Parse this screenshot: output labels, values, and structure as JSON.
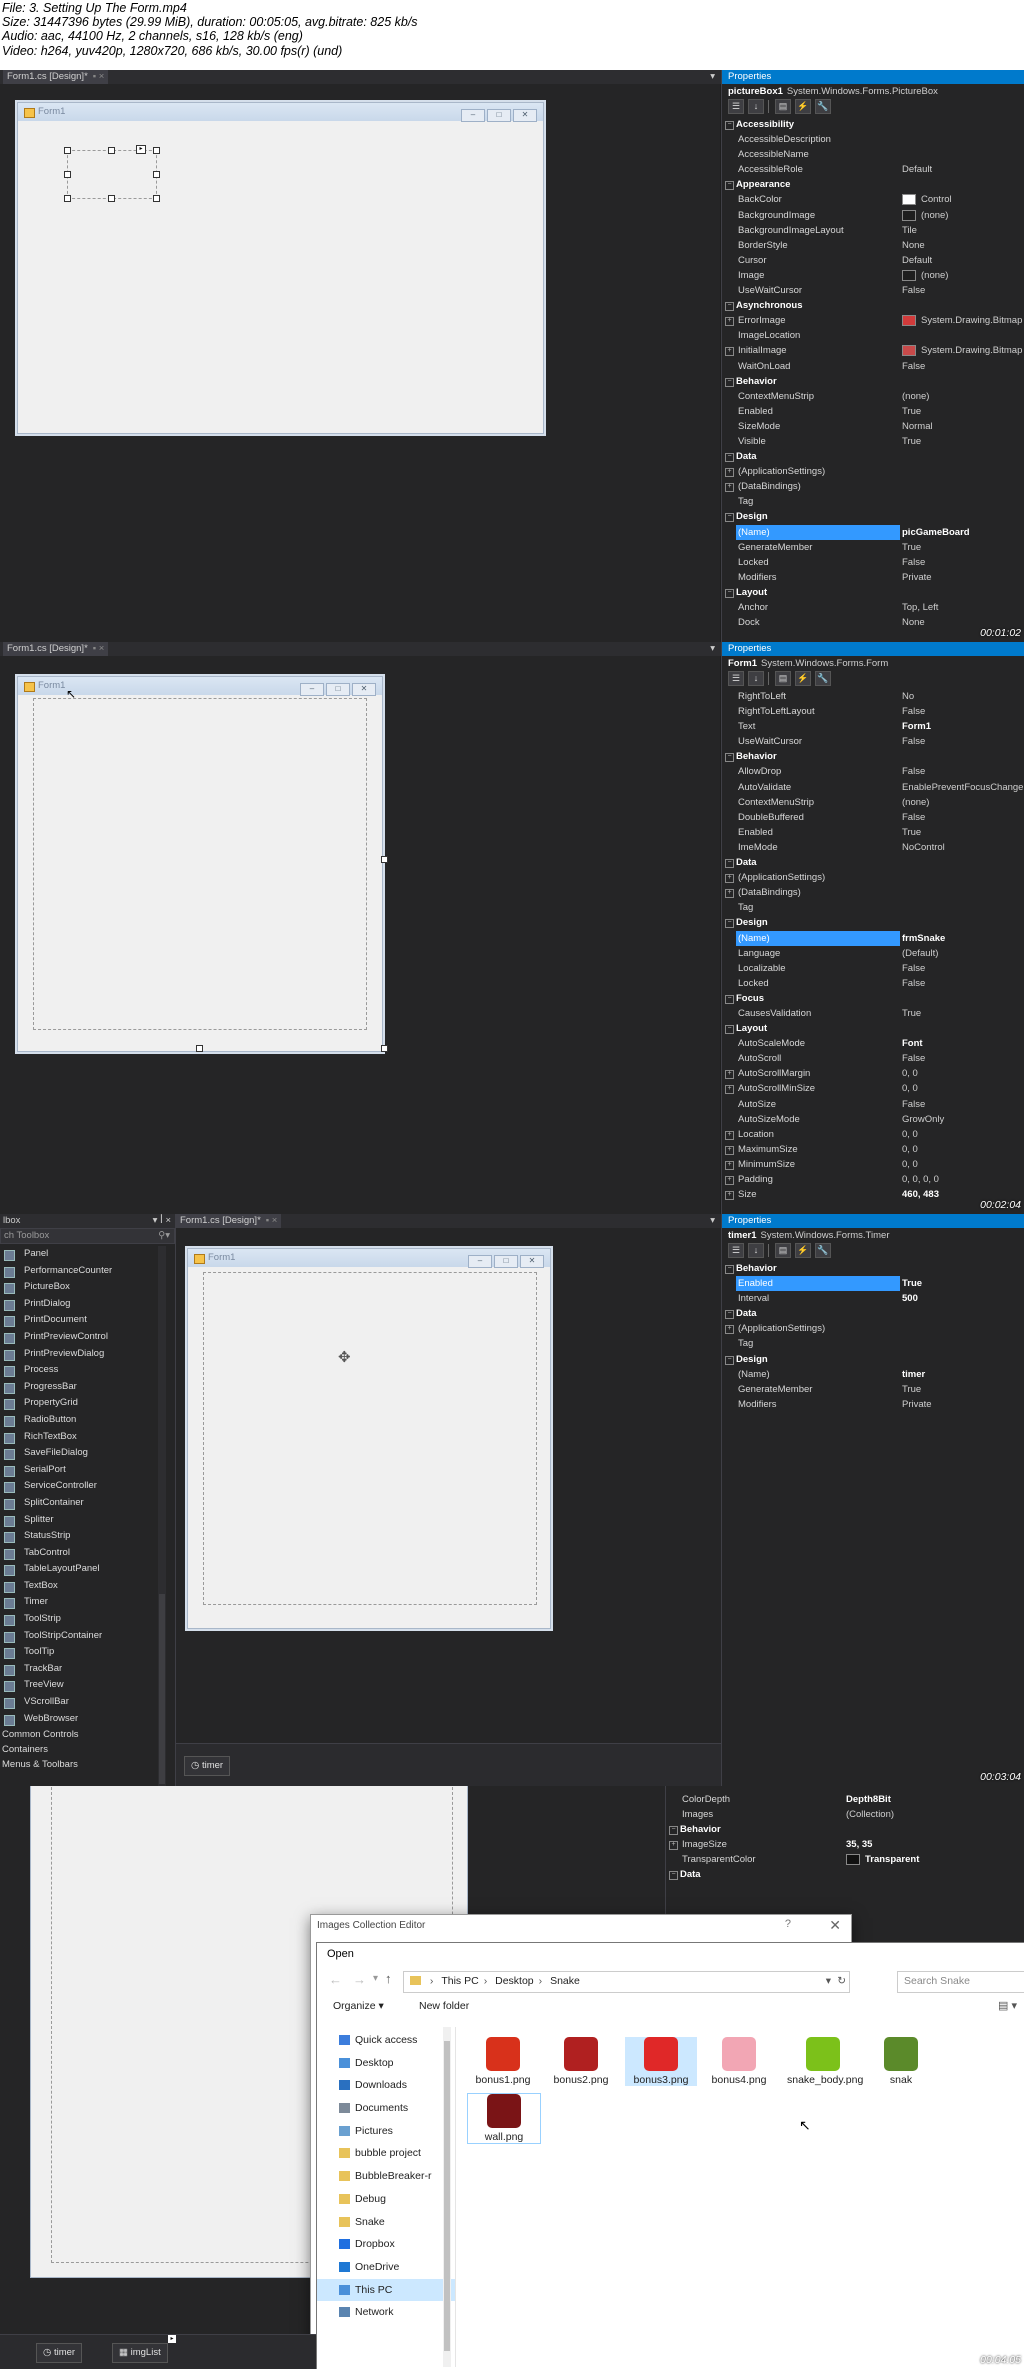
{
  "info": {
    "line1": "File: 3. Setting Up The Form.mp4",
    "line2": "Size: 31447396 bytes (29.99 MiB), duration: 00:05:05, avg.bitrate: 825 kb/s",
    "line3": "Audio: aac, 44100 Hz, 2 channels, s16, 128 kb/s (eng)",
    "line4": "Video: h264, yuv420p, 1280x720, 686 kb/s, 30.00 fps(r) (und)"
  },
  "frame1": {
    "tab": "Form1.cs [Design]*",
    "form_title": "Form1",
    "props_header": "Properties",
    "object": "pictureBox1",
    "object_type": "System.Windows.Forms.PictureBox",
    "timestamp": "00:01:02",
    "rows": [
      {
        "cat": "Accessibility"
      },
      {
        "n": "AccessibleDescription",
        "v": ""
      },
      {
        "n": "AccessibleName",
        "v": ""
      },
      {
        "n": "AccessibleRole",
        "v": "Default"
      },
      {
        "cat": "Appearance"
      },
      {
        "n": "BackColor",
        "v": "Control",
        "sw": "#ffffff"
      },
      {
        "n": "BackgroundImage",
        "v": "(none)",
        "sw": "#1e1e1e"
      },
      {
        "n": "BackgroundImageLayout",
        "v": "Tile"
      },
      {
        "n": "BorderStyle",
        "v": "None"
      },
      {
        "n": "Cursor",
        "v": "Default"
      },
      {
        "n": "Image",
        "v": "(none)",
        "sw": "#1e1e1e"
      },
      {
        "n": "UseWaitCursor",
        "v": "False"
      },
      {
        "cat": "Asynchronous"
      },
      {
        "n": "ErrorImage",
        "v": "System.Drawing.Bitmap",
        "sw": "#d23b3b",
        "exp": true
      },
      {
        "n": "ImageLocation",
        "v": ""
      },
      {
        "n": "InitialImage",
        "v": "System.Drawing.Bitmap",
        "sw": "#c84a4a",
        "exp": true
      },
      {
        "n": "WaitOnLoad",
        "v": "False"
      },
      {
        "cat": "Behavior"
      },
      {
        "n": "ContextMenuStrip",
        "v": "(none)"
      },
      {
        "n": "Enabled",
        "v": "True"
      },
      {
        "n": "SizeMode",
        "v": "Normal"
      },
      {
        "n": "Visible",
        "v": "True"
      },
      {
        "cat": "Data"
      },
      {
        "n": "(ApplicationSettings)",
        "v": "",
        "exp": true
      },
      {
        "n": "(DataBindings)",
        "v": "",
        "exp": true
      },
      {
        "n": "Tag",
        "v": ""
      },
      {
        "cat": "Design"
      },
      {
        "n": "(Name)",
        "v": "picGameBoard",
        "sel": true,
        "bold": true
      },
      {
        "n": "GenerateMember",
        "v": "True"
      },
      {
        "n": "Locked",
        "v": "False"
      },
      {
        "n": "Modifiers",
        "v": "Private"
      },
      {
        "cat": "Layout"
      },
      {
        "n": "Anchor",
        "v": "Top, Left"
      },
      {
        "n": "Dock",
        "v": "None"
      }
    ]
  },
  "frame2": {
    "tab": "Form1.cs [Design]*",
    "form_title": "Form1",
    "props_header": "Properties",
    "object": "Form1",
    "object_type": "System.Windows.Forms.Form",
    "timestamp": "00:02:04",
    "rows": [
      {
        "n": "RightToLeft",
        "v": "No"
      },
      {
        "n": "RightToLeftLayout",
        "v": "False"
      },
      {
        "n": "Text",
        "v": "Form1",
        "bold": true
      },
      {
        "n": "UseWaitCursor",
        "v": "False"
      },
      {
        "cat": "Behavior"
      },
      {
        "n": "AllowDrop",
        "v": "False"
      },
      {
        "n": "AutoValidate",
        "v": "EnablePreventFocusChange"
      },
      {
        "n": "ContextMenuStrip",
        "v": "(none)"
      },
      {
        "n": "DoubleBuffered",
        "v": "False"
      },
      {
        "n": "Enabled",
        "v": "True"
      },
      {
        "n": "ImeMode",
        "v": "NoControl"
      },
      {
        "cat": "Data"
      },
      {
        "n": "(ApplicationSettings)",
        "v": "",
        "exp": true
      },
      {
        "n": "(DataBindings)",
        "v": "",
        "exp": true
      },
      {
        "n": "Tag",
        "v": ""
      },
      {
        "cat": "Design"
      },
      {
        "n": "(Name)",
        "v": "frmSnake",
        "sel": true,
        "bold": true
      },
      {
        "n": "Language",
        "v": "(Default)"
      },
      {
        "n": "Localizable",
        "v": "False"
      },
      {
        "n": "Locked",
        "v": "False"
      },
      {
        "cat": "Focus"
      },
      {
        "n": "CausesValidation",
        "v": "True"
      },
      {
        "cat": "Layout"
      },
      {
        "n": "AutoScaleMode",
        "v": "Font",
        "bold": true
      },
      {
        "n": "AutoScroll",
        "v": "False"
      },
      {
        "n": "AutoScrollMargin",
        "v": "0, 0",
        "exp": true
      },
      {
        "n": "AutoScrollMinSize",
        "v": "0, 0",
        "exp": true
      },
      {
        "n": "AutoSize",
        "v": "False"
      },
      {
        "n": "AutoSizeMode",
        "v": "GrowOnly"
      },
      {
        "n": "Location",
        "v": "0, 0",
        "exp": true
      },
      {
        "n": "MaximumSize",
        "v": "0, 0",
        "exp": true
      },
      {
        "n": "MinimumSize",
        "v": "0, 0",
        "exp": true
      },
      {
        "n": "Padding",
        "v": "0, 0, 0, 0",
        "exp": true
      },
      {
        "n": "Size",
        "v": "460, 483",
        "bold": true,
        "exp": true
      }
    ]
  },
  "frame3": {
    "toolbox_title": "lbox",
    "toolbox_search": "ch Toolbox",
    "toolbox_items": [
      "Panel",
      "PerformanceCounter",
      "PictureBox",
      "PrintDialog",
      "PrintDocument",
      "PrintPreviewControl",
      "PrintPreviewDialog",
      "Process",
      "ProgressBar",
      "PropertyGrid",
      "RadioButton",
      "RichTextBox",
      "SaveFileDialog",
      "SerialPort",
      "ServiceController",
      "SplitContainer",
      "Splitter",
      "StatusStrip",
      "TabControl",
      "TableLayoutPanel",
      "TextBox",
      "Timer",
      "ToolStrip",
      "ToolStripContainer",
      "ToolTip",
      "TrackBar",
      "TreeView",
      "VScrollBar",
      "WebBrowser"
    ],
    "toolbox_groups": [
      "Common Controls",
      "Containers",
      "Menus & Toolbars"
    ],
    "tab": "Form1.cs [Design]*",
    "form_title": "Form1",
    "tray_item": "timer",
    "props_header": "Properties",
    "object": "timer1",
    "object_type": "System.Windows.Forms.Timer",
    "timestamp": "00:03:04",
    "rows": [
      {
        "cat": "Behavior"
      },
      {
        "n": "Enabled",
        "v": "True",
        "sel": true,
        "bold": true
      },
      {
        "n": "Interval",
        "v": "500",
        "bold": true
      },
      {
        "cat": "Data"
      },
      {
        "n": "(ApplicationSettings)",
        "v": "",
        "exp": true
      },
      {
        "n": "Tag",
        "v": ""
      },
      {
        "cat": "Design"
      },
      {
        "n": "(Name)",
        "v": "timer",
        "bold": true
      },
      {
        "n": "GenerateMember",
        "v": "True"
      },
      {
        "n": "Modifiers",
        "v": "Private"
      }
    ]
  },
  "frame4": {
    "timestamp": "00:04:05",
    "props_rows": [
      {
        "n": "ColorDepth",
        "v": "Depth8Bit",
        "bold": true
      },
      {
        "n": "Images",
        "v": "(Collection)"
      },
      {
        "cat": "Behavior"
      },
      {
        "n": "ImageSize",
        "v": "35, 35",
        "bold": true,
        "exp": true
      },
      {
        "n": "TransparentColor",
        "v": "Transparent",
        "bold": true,
        "sw": "#111111"
      },
      {
        "cat": "Data"
      }
    ],
    "collection_editor_title": "Images Collection Editor",
    "collection_help": "?",
    "open_title": "Open",
    "breadcrumb": [
      "This PC",
      "Desktop",
      "Snake"
    ],
    "search_placeholder": "Search Snake",
    "organize": "Organize ▾",
    "new_folder": "New folder",
    "nav": [
      {
        "label": "Quick access",
        "icon": "#3c7ddc"
      },
      {
        "label": "Desktop",
        "icon": "#4a90d9"
      },
      {
        "label": "Downloads",
        "icon": "#2a70c0"
      },
      {
        "label": "Documents",
        "icon": "#7d8a99"
      },
      {
        "label": "Pictures",
        "icon": "#6aa0d0"
      },
      {
        "label": "bubble project",
        "icon": "#e8c35a"
      },
      {
        "label": "BubbleBreaker-r",
        "icon": "#e8c35a"
      },
      {
        "label": "Debug",
        "icon": "#e8c35a"
      },
      {
        "label": "Snake",
        "icon": "#e8c35a"
      },
      {
        "label": "Dropbox",
        "icon": "#1f6fe0"
      },
      {
        "label": "OneDrive",
        "icon": "#1e78d4"
      },
      {
        "label": "This PC",
        "icon": "#4a8fd9"
      },
      {
        "label": "Network",
        "icon": "#5a84b0"
      }
    ],
    "files": [
      {
        "name": "bonus1.png",
        "color": "#d8311b"
      },
      {
        "name": "bonus2.png",
        "color": "#b02020"
      },
      {
        "name": "bonus3.png",
        "color": "#e02828"
      },
      {
        "name": "bonus4.png",
        "color": "#f2a6b4"
      },
      {
        "name": "snake_body.png",
        "color": "#7cc11a"
      },
      {
        "name": "snak",
        "color": "#5b8a2a"
      },
      {
        "name": "wall.png",
        "color": "#7a1416"
      }
    ],
    "tray_items": [
      "timer",
      "imgList"
    ]
  }
}
